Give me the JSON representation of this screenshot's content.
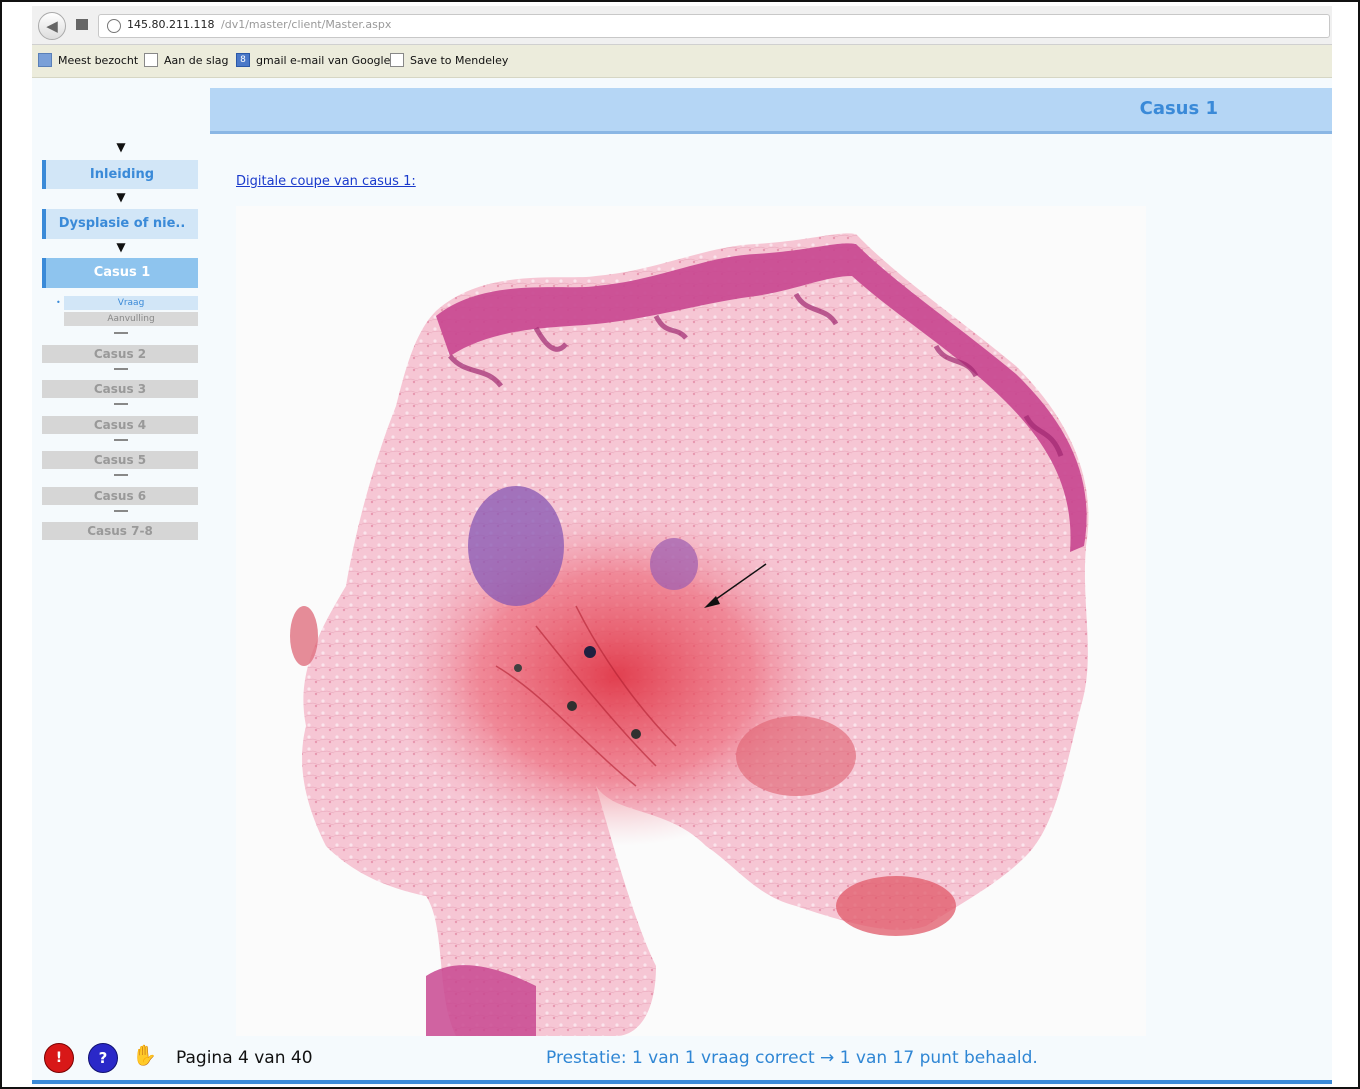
{
  "browser": {
    "url_ip": "145.80.211.118",
    "url_path": "/dv1/master/client/Master.aspx",
    "bookmarks": [
      {
        "label": "Meest bezocht",
        "icon": "people-icon"
      },
      {
        "label": "Aan de slag",
        "icon": "page-icon"
      },
      {
        "label": "gmail e-mail van Google",
        "icon": "google-icon"
      },
      {
        "label": "Save to Mendeley",
        "icon": "page-icon"
      }
    ]
  },
  "header": {
    "title": "Casus 1"
  },
  "nav": {
    "arrow": "▼",
    "items": [
      {
        "label": "Inleiding"
      },
      {
        "label": "Dysplasie of nie.."
      },
      {
        "label": "Casus 1"
      }
    ],
    "sub_items": [
      {
        "label": "Vraag",
        "bullet": "•"
      },
      {
        "label": "Aanvulling"
      }
    ],
    "locked_items": [
      {
        "label": "Casus 2"
      },
      {
        "label": "Casus 3"
      },
      {
        "label": "Casus 4"
      },
      {
        "label": "Casus 5"
      },
      {
        "label": "Casus 6"
      },
      {
        "label": "Casus 7-8"
      }
    ]
  },
  "main": {
    "link_label": "Digitale coupe van casus 1:"
  },
  "footer": {
    "red_button_glyph": "!",
    "help_glyph": "?",
    "hand_glyph": "✋",
    "pagina": "Pagina 4 van 40",
    "prestatie": "Prestatie: 1 van 1 vraag correct → 1 van 17 punt behaald."
  },
  "colors": {
    "accent": "#3a8ad8",
    "header_bg": "#b5d6f5",
    "tissue_pink": "#f0b8c8",
    "tissue_epithelium": "#c84890",
    "tissue_red": "#e85060"
  }
}
